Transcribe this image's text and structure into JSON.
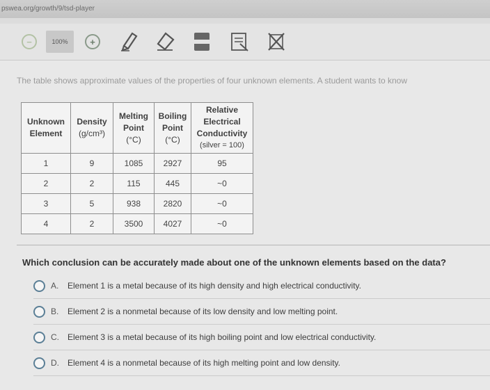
{
  "url": "pswea.org/growth/9/tsd-player",
  "toolbar": {
    "zoom_level": "100%",
    "icons": [
      "zoom-out-icon",
      "zoom-in-icon",
      "pencil-icon",
      "eraser-icon",
      "line-reader-icon",
      "flag-icon",
      "eliminate-icon"
    ]
  },
  "passage": {
    "intro": "The table shows approximate values of the properties of four unknown elements. A student wants to know"
  },
  "table": {
    "headers": [
      [
        "Unknown",
        "Element"
      ],
      [
        "Density",
        "(g/cm³)"
      ],
      [
        "Melting",
        "Point",
        "(°C)"
      ],
      [
        "Boiling",
        "Point",
        "(°C)"
      ],
      [
        "Relative",
        "Electrical",
        "Conductivity",
        "(silver = 100)"
      ]
    ],
    "rows": [
      [
        "1",
        "9",
        "1085",
        "2927",
        "95"
      ],
      [
        "2",
        "2",
        "115",
        "445",
        "~0"
      ],
      [
        "3",
        "5",
        "938",
        "2820",
        "~0"
      ],
      [
        "4",
        "2",
        "3500",
        "4027",
        "~0"
      ]
    ]
  },
  "question": {
    "text": "Which conclusion can be accurately made about one of the unknown elements based on the data?",
    "options": [
      {
        "letter": "A.",
        "text": "Element 1 is a metal because of its high density and high electrical conductivity."
      },
      {
        "letter": "B.",
        "text": "Element 2 is a nonmetal because of its low density and low melting point."
      },
      {
        "letter": "C.",
        "text": "Element 3 is a metal because of its high boiling point and low electrical conductivity."
      },
      {
        "letter": "D.",
        "text": "Element 4 is a nonmetal because of its high melting point and low density."
      }
    ]
  },
  "colors": {
    "radio_border": "#5b7f96",
    "toolbar_bg": "#e4e4e4",
    "content_bg": "#e8e8e8"
  }
}
